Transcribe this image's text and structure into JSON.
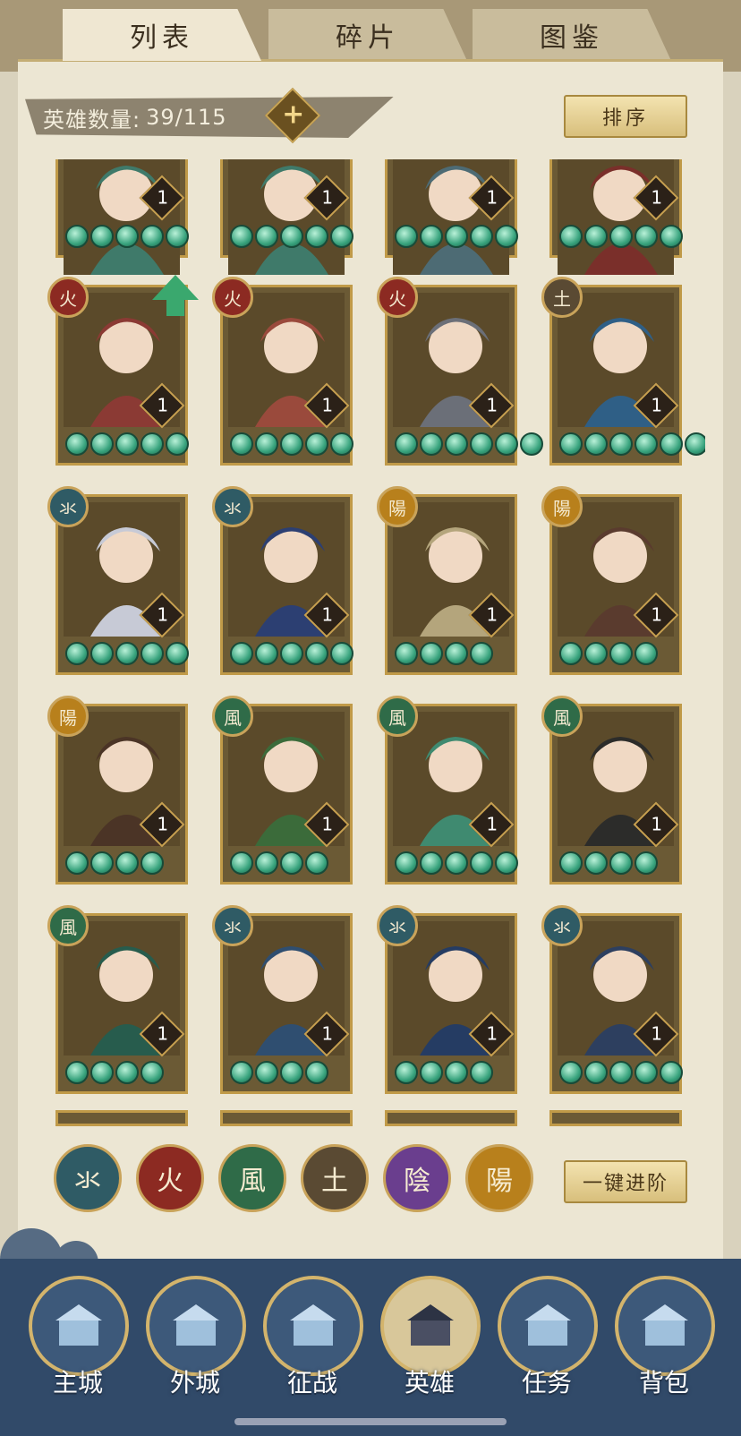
{
  "tabs": [
    {
      "label": "列表",
      "active": true
    },
    {
      "label": "碎片",
      "active": false
    },
    {
      "label": "图鉴",
      "active": false
    }
  ],
  "header": {
    "hero_count_label": "英雄数量:",
    "hero_count": "39/115",
    "plus_icon": "plus-icon",
    "sort_label": "排序"
  },
  "elements": {
    "water": {
      "glyph": "氺",
      "color": "#2f5b65"
    },
    "fire": {
      "glyph": "火",
      "color": "#8c2a22"
    },
    "wind": {
      "glyph": "風",
      "color": "#2f6b48"
    },
    "earth": {
      "glyph": "土",
      "color": "#5a4a33"
    },
    "yin": {
      "glyph": "陰",
      "color": "#6a3e8e"
    },
    "yang": {
      "glyph": "陽",
      "color": "#b8801c"
    }
  },
  "cards": [
    {
      "element": "",
      "level": "1",
      "gems": 5,
      "art": "#3f7a6a"
    },
    {
      "element": "",
      "level": "1",
      "gems": 5,
      "art": "#3f7a6a"
    },
    {
      "element": "",
      "level": "1",
      "gems": 5,
      "art": "#4d6b74"
    },
    {
      "element": "",
      "level": "1",
      "gems": 5,
      "art": "#7a2f2a"
    },
    {
      "element": "fire",
      "level": "1",
      "gems": 5,
      "art": "#8b3a34",
      "upgrade": true
    },
    {
      "element": "fire",
      "level": "1",
      "gems": 5,
      "art": "#9a4a3c"
    },
    {
      "element": "fire",
      "level": "1",
      "gems": 6,
      "art": "#6b6f78"
    },
    {
      "element": "earth",
      "level": "1",
      "gems": 6,
      "art": "#2f5f86"
    },
    {
      "element": "water",
      "level": "1",
      "gems": 5,
      "art": "#c7cad6"
    },
    {
      "element": "water",
      "level": "1",
      "gems": 5,
      "art": "#2c3f72"
    },
    {
      "element": "yang",
      "level": "1",
      "gems": 4,
      "art": "#b4a57c"
    },
    {
      "element": "yang",
      "level": "1",
      "gems": 4,
      "art": "#5a3b2e"
    },
    {
      "element": "yang",
      "level": "1",
      "gems": 4,
      "art": "#4b3426"
    },
    {
      "element": "wind",
      "level": "1",
      "gems": 4,
      "art": "#3b6b3a"
    },
    {
      "element": "wind",
      "level": "1",
      "gems": 5,
      "art": "#3f8a70"
    },
    {
      "element": "wind",
      "level": "1",
      "gems": 4,
      "art": "#2c2c2a"
    },
    {
      "element": "wind",
      "level": "1",
      "gems": 4,
      "art": "#275c4d"
    },
    {
      "element": "water",
      "level": "1",
      "gems": 4,
      "art": "#2f4e70"
    },
    {
      "element": "water",
      "level": "1",
      "gems": 4,
      "art": "#253c63"
    },
    {
      "element": "water",
      "level": "1",
      "gems": 5,
      "art": "#2d3f5f"
    }
  ],
  "filters": [
    "water",
    "fire",
    "wind",
    "earth",
    "yin",
    "yang"
  ],
  "one_click_upgrade_label": "一键进阶",
  "nav": [
    {
      "label": "主城",
      "icon": "main-city-icon",
      "active": false
    },
    {
      "label": "外城",
      "icon": "outer-city-icon",
      "active": false
    },
    {
      "label": "征战",
      "icon": "battle-icon",
      "active": false
    },
    {
      "label": "英雄",
      "icon": "hero-icon",
      "active": true
    },
    {
      "label": "任务",
      "icon": "task-icon",
      "active": false
    },
    {
      "label": "背包",
      "icon": "bag-icon",
      "active": false
    }
  ]
}
